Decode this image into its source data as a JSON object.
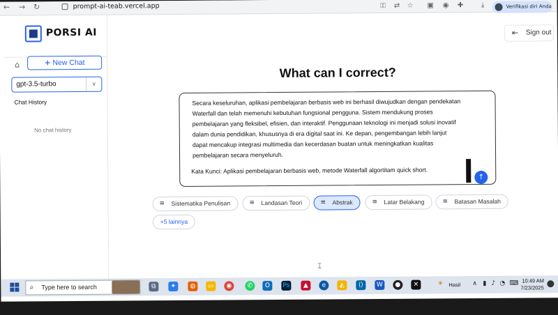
{
  "browser": {
    "url": "prompt-ai-teab.vercel.app",
    "profile_label": "Verifikasi diri Anda"
  },
  "sidebar": {
    "logo_text": "PORSI AI",
    "new_chat_label": "New Chat",
    "model_selected": "gpt-3.5-turbo",
    "history_title": "Chat History",
    "empty_history": "No chat history"
  },
  "header": {
    "signout_label": "Sign out"
  },
  "main": {
    "title": "What can I correct?",
    "essay_text": "Secara keseluruhan, aplikasi pembelajaran berbasis web ini berhasil diwujudkan dengan pendekatan Waterfall dan telah memenuhi kebutuhan fungsional pengguna. Sistem mendukung proses pembelajaran yang fleksibel, efisien, dan interaktif. Penggunaan teknologi ini menjadi solusi inovatif dalam dunia pendidikan, khususnya di era digital saat ini. Ke depan, pengembangan lebih lanjut dapat mencakup integrasi multimedia dan kecerdasan buatan untuk meningkatkan kualitas pembelajaran secara menyeluruh.",
    "keywords_text": "Kata Kunci:  Aplikasi pembelajaran berbasis web, metode Waterfall algortitam quick short.",
    "chips": [
      {
        "label": "Sistematika Penulisan"
      },
      {
        "label": "Landasan Teori"
      },
      {
        "label": "Abstrak"
      },
      {
        "label": "Latar Belakang"
      },
      {
        "label": "Batasan Masalah"
      }
    ],
    "more_label": "+5 lainnya"
  },
  "taskbar": {
    "search_placeholder": "Type here to search",
    "weather_label": "Hasil",
    "time": "10:49 AM",
    "date": "7/23/2025"
  },
  "colors": {
    "accent": "#2563eb",
    "active_chip_bg": "#dbe8fd"
  },
  "icons": {
    "home": "home-icon",
    "signout": "signout-icon",
    "send": "arrow-up-icon",
    "chip": "edit-lines-icon"
  }
}
